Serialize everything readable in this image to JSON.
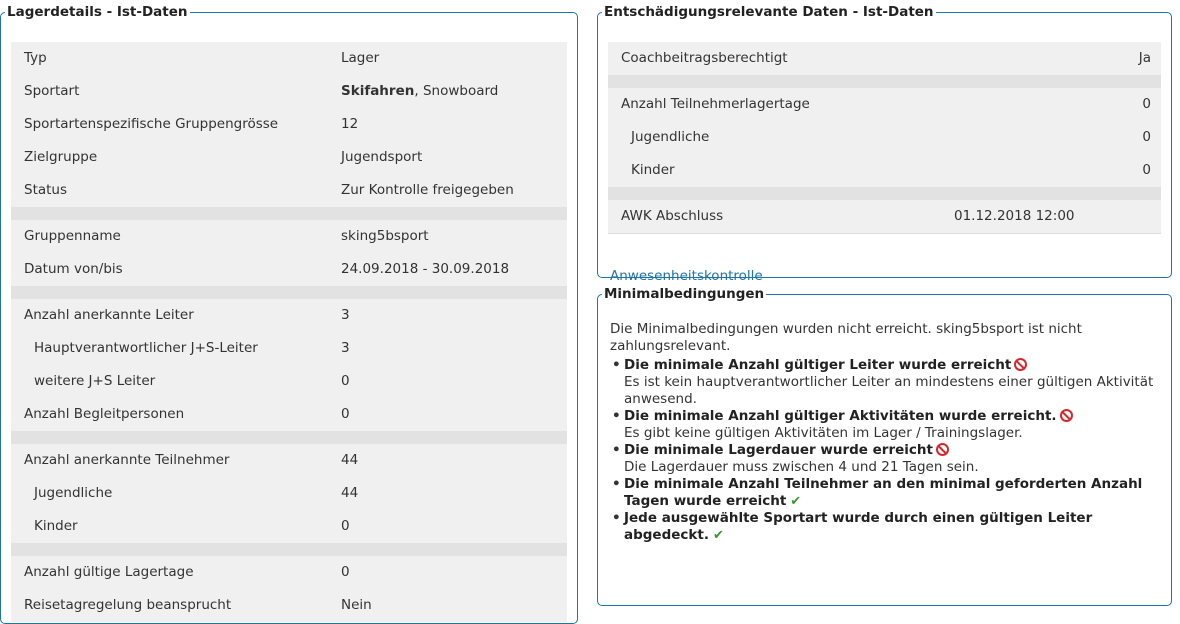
{
  "lagerdetails": {
    "legend": "Lagerdetails - Ist-Daten",
    "rows": [
      {
        "label": "Typ",
        "value": "Lager"
      },
      {
        "label": "Sportart",
        "value_bold": "Skifahren",
        "value_rest": ", Snowboard"
      },
      {
        "label": "Sportartenspezifische Gruppengrösse",
        "value": "12"
      },
      {
        "label": "Zielgruppe",
        "value": "Jugendsport"
      },
      {
        "label": "Status",
        "value": "Zur Kontrolle freigegeben"
      },
      {
        "label": "Gruppenname",
        "value": "sking5bsport"
      },
      {
        "label": "Datum von/bis",
        "value": "24.09.2018 - 30.09.2018"
      },
      {
        "label": "Anzahl anerkannte Leiter",
        "value": "3"
      },
      {
        "label": "Hauptverantwortlicher J+S-Leiter",
        "value": "3"
      },
      {
        "label": "weitere J+S Leiter",
        "value": "0"
      },
      {
        "label": "Anzahl Begleitpersonen",
        "value": "0"
      },
      {
        "label": "Anzahl anerkannte Teilnehmer",
        "value": "44"
      },
      {
        "label": "Jugendliche",
        "value": "44"
      },
      {
        "label": "Kinder",
        "value": "0"
      },
      {
        "label": "Anzahl gültige Lagertage",
        "value": "0"
      },
      {
        "label": "Reisetagregelung beansprucht",
        "value": "Nein"
      }
    ]
  },
  "entschaedigung": {
    "legend": "Entschädigungsrelevante Daten - Ist-Daten",
    "rows": [
      {
        "label": "Coachbeitragsberechtigt",
        "value": "Ja"
      },
      {
        "label": "Anzahl Teilnehmerlagertage",
        "value": "0"
      },
      {
        "label": "Jugendliche",
        "value": "0"
      },
      {
        "label": "Kinder",
        "value": "0"
      },
      {
        "label": "AWK Abschluss",
        "value": "01.12.2018 12:00"
      }
    ],
    "link": "Anwesenheitskontrolle"
  },
  "minimal": {
    "legend": "Minimalbedingungen",
    "intro": "Die Minimalbedingungen wurden nicht erreicht. sking5bsport ist nicht zahlungsrelevant.",
    "bullet": "•",
    "items": [
      {
        "title": "Die minimale Anzahl gültiger Leiter wurde erreicht",
        "desc": "Es ist kein hauptverantwortlicher Leiter an mindestens einer gültigen Aktivität anwesend.",
        "status": "not-ok"
      },
      {
        "title": "Die minimale Anzahl gültiger Aktivitäten wurde erreicht.",
        "desc": "Es gibt keine gültigen Aktivitäten im Lager / Trainingslager.",
        "status": "not-ok"
      },
      {
        "title": "Die minimale Lagerdauer wurde erreicht",
        "desc": "Die Lagerdauer muss zwischen 4 und 21 Tagen sein.",
        "status": "not-ok"
      },
      {
        "title": "Die minimale Anzahl Teilnehmer an den minimal geforderten Anzahl Tagen wurde erreicht",
        "desc": "",
        "status": "ok"
      },
      {
        "title": "Jede ausgewählte Sportart wurde durch einen gültigen Leiter abgedeckt.",
        "desc": "",
        "status": "ok"
      }
    ],
    "ok_icon": "checkmark-icon",
    "not_ok_icon": "forbidden-icon",
    "ok_glyph": "✔"
  },
  "colors": {
    "border": "#1f74a8",
    "table_bg": "#f0f0f0",
    "spacer": "#e2e2e2",
    "link": "#1f74a8",
    "error": "#d9262c",
    "success": "#2e9b2e"
  }
}
